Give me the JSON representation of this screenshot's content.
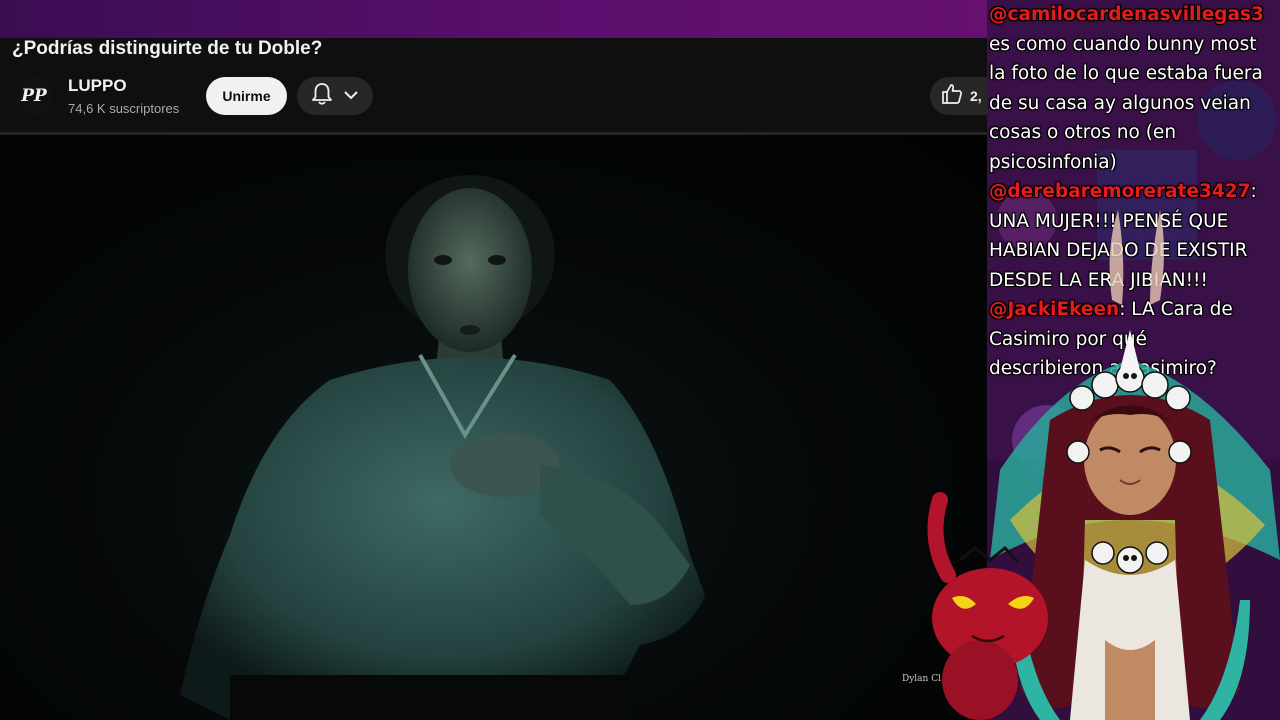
{
  "video": {
    "title": "¿Podrías distinguirte de tu Doble?",
    "credit": "Dylan Cl..."
  },
  "channel": {
    "name": "LUPPO",
    "subscribers": "74,6 K suscriptores",
    "avatar_text": "PP"
  },
  "actions": {
    "join_label": "Unirme",
    "like_count": "2,",
    "bell_icon": "bell-icon",
    "like_icon": "thumbs-up-icon"
  },
  "chat": {
    "lines": [
      {
        "user": "@camilocardenasvillegas3",
        "text": ""
      },
      {
        "user": "",
        "text": "es como cuando bunny most"
      },
      {
        "user": "",
        "text": "la foto de lo que estaba fuera"
      },
      {
        "user": "",
        "text": "de su casa ay algunos veian"
      },
      {
        "user": "",
        "text": "cosas o otros no (en"
      },
      {
        "user": "",
        "text": "psicosinfonia)"
      },
      {
        "user": "@derebaremorerate3427",
        "text": ":"
      },
      {
        "user": "",
        "text": "UNA MUJER!!! PENSÉ QUE"
      },
      {
        "user": "",
        "text": "HABIAN DEJADO DE EXISTIR"
      },
      {
        "user": "",
        "text": "DESDE LA ERA JIBIAN!!!"
      },
      {
        "user": "@JackiEkeen",
        "text": ": LA Cara de"
      },
      {
        "user": "",
        "text": "Casimiro por qué"
      },
      {
        "user": "",
        "text": "describieron a Casimiro?"
      }
    ]
  },
  "colors": {
    "chat_username": "#e41c1c",
    "chat_text": "#ffffff",
    "yt_background": "#0f0f0f",
    "top_band": "#5c0f6e"
  }
}
